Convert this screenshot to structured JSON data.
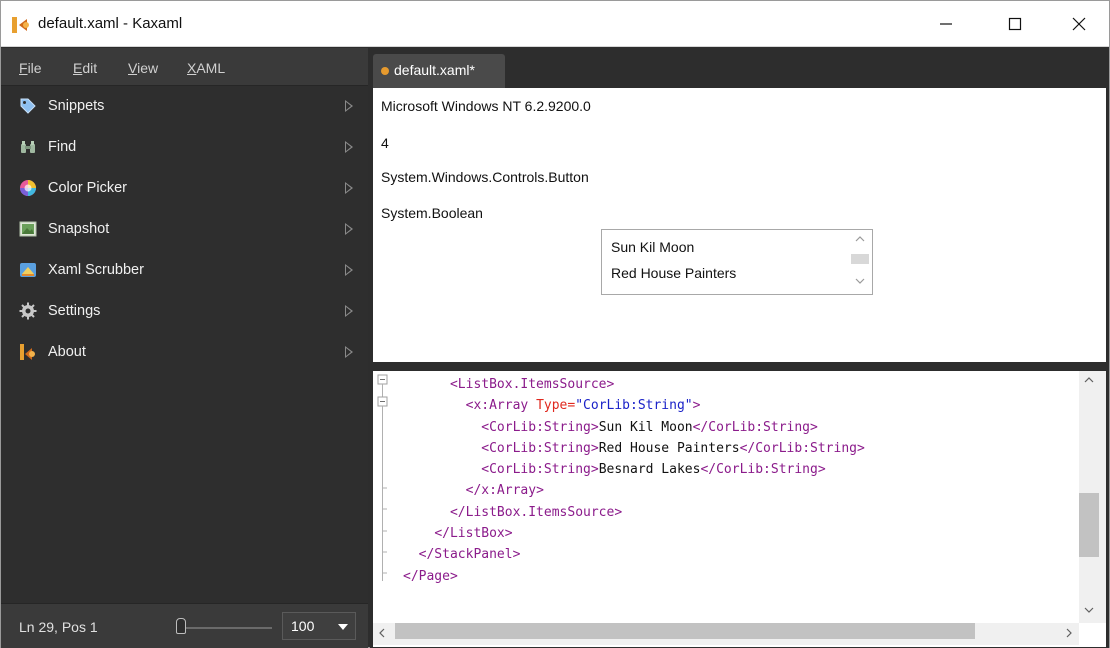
{
  "window": {
    "title": "default.xaml - Kaxaml",
    "app_icon": "kaxaml-logo-icon",
    "controls": [
      "minimize-icon",
      "maximize-icon",
      "close-icon"
    ]
  },
  "menubar": {
    "items": [
      {
        "label": "File"
      },
      {
        "label": "Edit"
      },
      {
        "label": "View"
      },
      {
        "label": "XAML"
      }
    ]
  },
  "sidebar": {
    "items": [
      {
        "label": "Snippets",
        "icon": "tag-icon"
      },
      {
        "label": "Find",
        "icon": "binoculars-icon"
      },
      {
        "label": "Color Picker",
        "icon": "color-wheel-icon"
      },
      {
        "label": "Snapshot",
        "icon": "picture-icon"
      },
      {
        "label": "Xaml Scrubber",
        "icon": "scrubber-icon"
      },
      {
        "label": "Settings",
        "icon": "gear-icon"
      },
      {
        "label": "About",
        "icon": "kaxaml-logo-icon"
      }
    ]
  },
  "status": {
    "position": "Ln 29, Pos 1",
    "zoom": "100"
  },
  "tab": {
    "label": "default.xaml*",
    "modified_color": "#e69a2e"
  },
  "preview": {
    "lines": [
      "Microsoft Windows NT 6.2.9200.0",
      "4",
      "System.Windows.Controls.Button",
      "System.Boolean"
    ],
    "listbox_items": [
      "Sun Kil Moon",
      "Red House Painters"
    ]
  },
  "editor": {
    "code_lines": [
      {
        "indent": "      ",
        "parts": [
          {
            "t": "tag",
            "v": "<ListBox.ItemsSource>"
          }
        ]
      },
      {
        "indent": "        ",
        "parts": [
          {
            "t": "tag",
            "v": "<x:Array "
          },
          {
            "t": "attr",
            "v": "Type="
          },
          {
            "t": "val",
            "v": "\"CorLib:String\""
          },
          {
            "t": "tag",
            "v": ">"
          }
        ]
      },
      {
        "indent": "          ",
        "parts": [
          {
            "t": "tag",
            "v": "<CorLib:String>"
          },
          {
            "t": "text",
            "v": "Sun Kil Moon"
          },
          {
            "t": "tag",
            "v": "</CorLib:String>"
          }
        ]
      },
      {
        "indent": "          ",
        "parts": [
          {
            "t": "tag",
            "v": "<CorLib:String>"
          },
          {
            "t": "text",
            "v": "Red House Painters"
          },
          {
            "t": "tag",
            "v": "</CorLib:String>"
          }
        ]
      },
      {
        "indent": "          ",
        "parts": [
          {
            "t": "tag",
            "v": "<CorLib:String>"
          },
          {
            "t": "text",
            "v": "Besnard Lakes"
          },
          {
            "t": "tag",
            "v": "</CorLib:String>"
          }
        ]
      },
      {
        "indent": "        ",
        "parts": [
          {
            "t": "tag",
            "v": "</x:Array>"
          }
        ]
      },
      {
        "indent": "      ",
        "parts": [
          {
            "t": "tag",
            "v": "</ListBox.ItemsSource>"
          }
        ]
      },
      {
        "indent": "    ",
        "parts": [
          {
            "t": "tag",
            "v": "</ListBox>"
          }
        ]
      },
      {
        "indent": "  ",
        "parts": [
          {
            "t": "tag",
            "v": "</StackPanel>"
          }
        ]
      },
      {
        "indent": "",
        "parts": [
          {
            "t": "tag",
            "v": "</Page>"
          }
        ]
      }
    ],
    "colors": {
      "tag": "#8b1b8b",
      "attr": "#e0281e",
      "value": "#1a22c8",
      "text": "#111111"
    }
  }
}
